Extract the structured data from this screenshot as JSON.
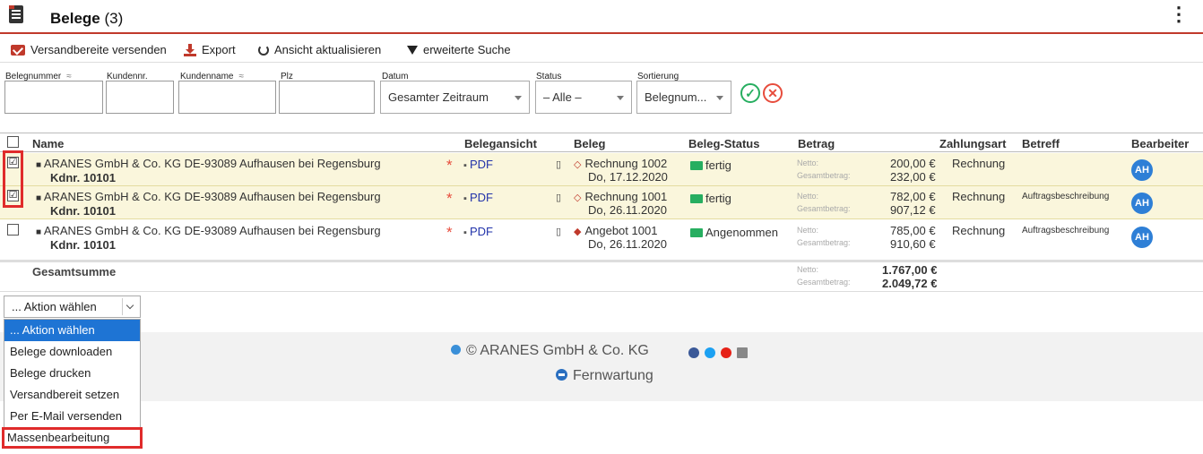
{
  "header": {
    "title": "Belege",
    "count": "(3)"
  },
  "toolbar": {
    "send": "Versandbereite versenden",
    "export": "Export",
    "refresh": "Ansicht aktualisieren",
    "search": "erweiterte Suche"
  },
  "filters": {
    "belegnummer": "Belegnummer",
    "kundennr": "Kundennr.",
    "kundenname": "Kundenname",
    "plz": "Plz",
    "approx": "≈",
    "datum_label": "Datum",
    "datum_value": "Gesamter Zeitraum",
    "status_label": "Status",
    "status_value": "– Alle –",
    "sort_label": "Sortierung",
    "sort_value": "Belegnum..."
  },
  "table": {
    "headers": {
      "name": "Name",
      "ansicht": "Belegansicht",
      "beleg": "Beleg",
      "status": "Beleg-Status",
      "betrag": "Betrag",
      "zahlungsart": "Zahlungsart",
      "betreff": "Betreff",
      "bearbeiter": "Bearbeiter"
    },
    "netto_label": "Netto:",
    "gesamt_label": "Gesamtbetrag:",
    "rows": [
      {
        "checked": "☑",
        "name": "ARANES GmbH & Co. KG DE-93089 Aufhausen bei Regensburg",
        "kdnr": "Kdnr. 10101",
        "pdf": "PDF",
        "beleg": "Rechnung 1002",
        "datum": "Do, 17.12.2020",
        "status": "fertig",
        "netto": "200,00 €",
        "gesamt": "232,00 €",
        "zahlungsart": "Rechnung",
        "betreff": "",
        "bearbeiter": "AH"
      },
      {
        "checked": "☑",
        "name": "ARANES GmbH & Co. KG DE-93089 Aufhausen bei Regensburg",
        "kdnr": "Kdnr. 10101",
        "pdf": "PDF",
        "beleg": "Rechnung 1001",
        "datum": "Do, 26.11.2020",
        "status": "fertig",
        "netto": "782,00 €",
        "gesamt": "907,12 €",
        "zahlungsart": "Rechnung",
        "betreff": "Auftragsbeschreibung",
        "bearbeiter": "AH"
      },
      {
        "checked": "",
        "name": "ARANES GmbH & Co. KG DE-93089 Aufhausen bei Regensburg",
        "kdnr": "Kdnr. 10101",
        "pdf": "PDF",
        "beleg": "Angebot 1001",
        "datum": "Do, 26.11.2020",
        "status": "Angenommen",
        "netto": "785,00 €",
        "gesamt": "910,60 €",
        "zahlungsart": "Rechnung",
        "betreff": "Auftragsbeschreibung",
        "bearbeiter": "AH"
      }
    ],
    "sum": {
      "label": "Gesamtsumme",
      "netto": "1.767,00 €",
      "gesamt": "2.049,72 €"
    }
  },
  "action": {
    "selected": "... Aktion wählen",
    "options": [
      "... Aktion wählen",
      "Belege downloaden",
      "Belege drucken",
      "Versandbereit setzen",
      "Per E-Mail versenden",
      "Massenbearbeitung"
    ]
  },
  "footer": {
    "copyright": "© ARANES GmbH & Co. KG",
    "remote": "Fernwartung"
  },
  "colors": {
    "accent": "#c0392b",
    "selected_row": "#faf6dc",
    "highlight": "#1e74d4",
    "avatar": "#2e7fd6"
  }
}
